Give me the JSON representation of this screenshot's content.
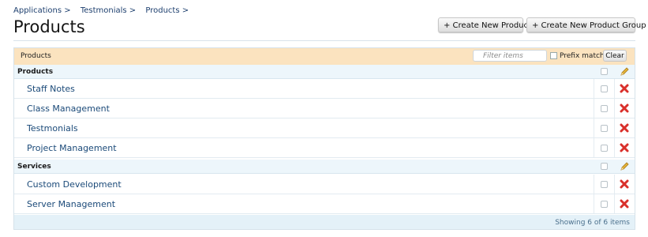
{
  "breadcrumb": [
    {
      "label": "Applications >"
    },
    {
      "label": "Testmonials >"
    },
    {
      "label": "Products >"
    }
  ],
  "page_title": "Products",
  "toolbar": {
    "create_product_label": "+ Create New Product",
    "create_group_label": "+ Create New Product Group"
  },
  "panel": {
    "title": "Products",
    "filter_placeholder": "Filter items",
    "prefix_match_label": "Prefix match",
    "clear_label": "Clear"
  },
  "groups": [
    {
      "name": "Products",
      "items": [
        "Staff Notes",
        "Class Management",
        "Testmonials",
        "Project Management"
      ]
    },
    {
      "name": "Services",
      "items": [
        "Custom Development",
        "Server Management"
      ]
    }
  ],
  "footer_text": "Showing 6 of 6 items",
  "colors": {
    "header_bg": "#fbe3bf",
    "link": "#1b4a79",
    "delete_icon": "#d9302b",
    "edit_icon": "#d8a62a"
  }
}
